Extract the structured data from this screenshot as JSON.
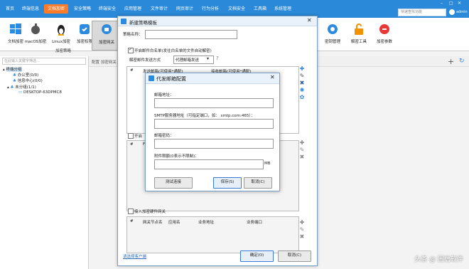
{
  "nav": {
    "tabs": [
      "首页",
      "终端信息",
      "文档加密",
      "安全策略",
      "终端安全",
      "应用管理",
      "文件审计",
      "网页审计",
      "行为分析",
      "文档安全",
      "工具箱",
      "系统管理"
    ],
    "active_index": 2,
    "quick_search_placeholder": "快速查找功能",
    "user": "admin"
  },
  "toolbar": {
    "buttons": [
      "文档加密",
      "macOS加密",
      "Linux加密",
      "加密权限",
      "加密网关"
    ],
    "right_buttons": [
      "密钥管理",
      "解密工具",
      "加密参数"
    ],
    "section_label": "加密策略"
  },
  "left": {
    "search_placeholder": "在此输入关键字筛选...",
    "tree": [
      "终端分组",
      "办公室(0/0)",
      "信息中心(0/0)",
      "未分组(1/1)",
      "DESKTOP-63DPMC8"
    ]
  },
  "right_header": "配置 加密网关",
  "dialog": {
    "title": "新建策略模板",
    "policy_name_label": "策略名称：",
    "whitelist_label": "开启邮件白名单(发往白名单的文件自动解密)",
    "send_method_label": "解密邮件发送方式",
    "send_method_value": "代理邮箱发送",
    "help": "?",
    "table_headers": [
      "#",
      "发送邮箱(可使用*通配)",
      "接收邮箱(可使用*通配)"
    ],
    "second_check_label": "开启",
    "second_table_hash": "#",
    "second_table_fi": "Fi",
    "gateway_label": "接入加密硬件网关",
    "gateway_headers": [
      "#",
      "网关节点名",
      "应用名",
      "业务地址",
      "业务端口"
    ],
    "link": "请选择客户端",
    "ok": "确定(O)",
    "cancel": "取消(C)"
  },
  "subdialog": {
    "title": "代发邮箱配置",
    "email_label": "邮箱地址：",
    "smtp_label": "SMTP服务器地址（可指定端口，如：  smtp.com:465）：",
    "password_label": "邮箱密码：",
    "attach_label": "附件限额(0表示不限制)：",
    "attach_unit": "MB",
    "test": "测试连接",
    "save": "保存(S)",
    "cancel": "取消(C)"
  },
  "watermark": "头条 @ 固信软件",
  "colors": {
    "nav": "#2a8ad9",
    "accent": "#ff7b28"
  }
}
